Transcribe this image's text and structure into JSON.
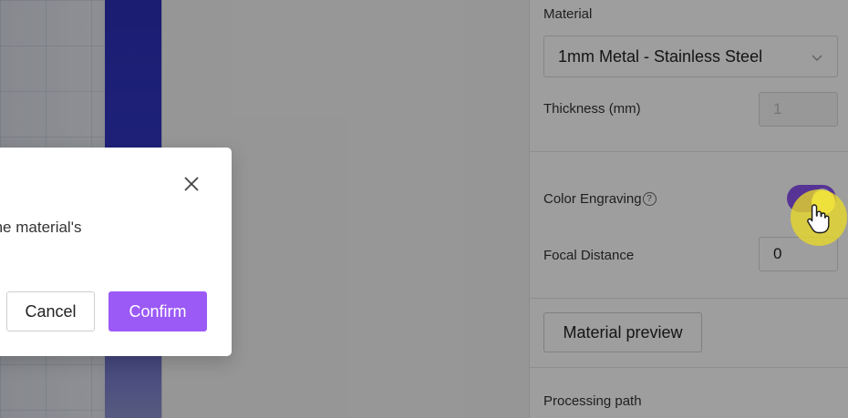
{
  "panel": {
    "material_label": "Material",
    "material_value": "1mm Metal - Stainless Steel",
    "thickness_label": "Thickness (mm)",
    "thickness_value": "1",
    "color_engraving_label": "Color Engraving",
    "color_engraving_on": true,
    "focal_distance_label": "Focal Distance",
    "focal_distance_value": "0",
    "material_preview_button": "Material preview",
    "processing_path_label": "Processing path"
  },
  "dialog": {
    "message_visible": "ording to the material's",
    "cancel_label": "Cancel",
    "confirm_label": "Confirm"
  },
  "colors": {
    "accent": "#9b59f6",
    "toggle_on": "#8c53f0",
    "canvas_stripe": "#2b2fb8"
  },
  "icons": {
    "close": "close-icon",
    "chevron": "chevron-down-icon",
    "help": "help-circle-icon",
    "cursor": "hand-pointer-icon"
  }
}
